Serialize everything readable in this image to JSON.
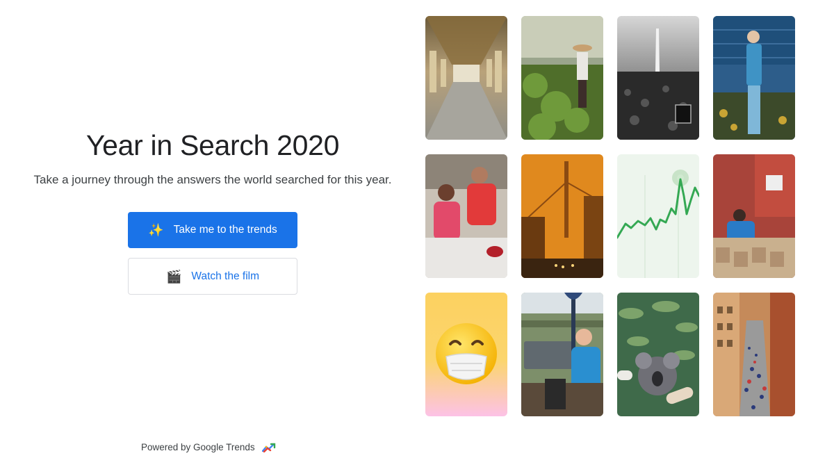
{
  "page": {
    "title": "Year in Search 2020",
    "subtitle": "Take a journey through the answers the world searched for this year.",
    "primary_button": {
      "label": "Take me to the trends",
      "icon": "sparkles-icon"
    },
    "secondary_button": {
      "label": "Watch the film",
      "icon": "clapper-board-icon"
    },
    "footer": {
      "text": "Powered by Google Trends",
      "icon": "google-trends-logo"
    }
  },
  "colors": {
    "accent": "#1a73e8",
    "text": "#202124",
    "border": "#dadce0"
  },
  "tiles": [
    "hall-of-mirrors-photo",
    "gardener-photo",
    "march-on-washington-photo",
    "nurse-photo",
    "food-distribution-photo",
    "orange-sky-bay-bridge-photo",
    "trend-line-graphic",
    "food-bank-volunteer-photo",
    "mask-emoji-graphic",
    "patio-man-photo",
    "koala-photo",
    "crowded-street-photo"
  ]
}
